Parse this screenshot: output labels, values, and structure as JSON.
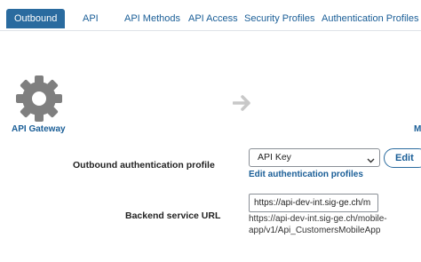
{
  "tabs": [
    {
      "label": "Outbound",
      "active": true
    },
    {
      "label": "API",
      "active": false
    },
    {
      "label": "API Methods",
      "active": false
    },
    {
      "label": "API Access",
      "active": false
    },
    {
      "label": "Security Profiles",
      "active": false
    },
    {
      "label": "Authentication Profiles",
      "active": false
    }
  ],
  "diagram": {
    "gateway_label": "API Gateway",
    "gateway_icon": "gear-icon",
    "arrow_icon": "arrow-right-icon",
    "right_label_partial": "M"
  },
  "form": {
    "auth_profile_label": "Outbound authentication profile",
    "auth_profile_value": "API Key",
    "edit_button_label": "Edit",
    "edit_auth_link": "Edit authentication profiles",
    "backend_url_label": "Backend service URL",
    "backend_url_value": "https://api-dev-int.sig-ge.ch/m",
    "backend_url_full": "https://api-dev-int.sig-ge.ch/mobile-app/v1/Api_CustomersMobileApp"
  },
  "colors": {
    "accent": "#2a6b9f",
    "link": "#1a5e97",
    "gear": "#7f7f7f",
    "arrow": "#c8c8c8"
  }
}
